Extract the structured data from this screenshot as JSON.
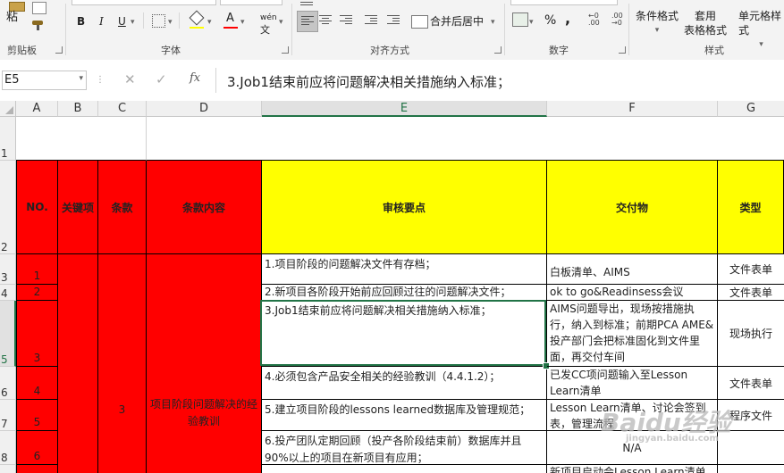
{
  "ribbon": {
    "clipboard": {
      "paste_label": "粘",
      "group_label": "剪贴板"
    },
    "font": {
      "group_label": "字体",
      "bold": "B",
      "italic": "I",
      "underline": "U",
      "font_color_glyph": "A",
      "phonetic": "wén"
    },
    "alignment": {
      "group_label": "对齐方式",
      "merge_label": "合并后居中"
    },
    "number": {
      "group_label": "数字",
      "percent": "%",
      "comma": ","
    },
    "styles": {
      "group_label": "样式",
      "conditional_label": "条件格式",
      "table_label_1": "套用",
      "table_label_2": "表格格式",
      "cell_style_label": "单元格样式"
    }
  },
  "formula_bar": {
    "name_box": "E5",
    "fx": "fx",
    "content": "3.Job1结束前应将问题解决相关措施纳入标准；"
  },
  "columns": [
    "A",
    "B",
    "C",
    "D",
    "E",
    "F",
    "G"
  ],
  "selected_column": "E",
  "rows": [
    "1",
    "2",
    "3",
    "4",
    "5",
    "6",
    "7",
    "8"
  ],
  "selected_row": "5",
  "header_row": {
    "no": "NO.",
    "key": "关键项",
    "clause": "条款",
    "clause_content": "条款内容",
    "audit_points": "审核要点",
    "deliverables": "交付物",
    "type": "类型"
  },
  "merged": {
    "clause": "3",
    "clause_content": "项目阶段问题解决的经验教训"
  },
  "data_rows": [
    {
      "no": "1",
      "audit": "1.项目阶段的问题解决文件有存档；",
      "deliverable": "白板清单、AIMS",
      "type": "文件表单"
    },
    {
      "no": "2",
      "audit": "2.新项目各阶段开始前应回顾过往的问题解决文件；",
      "deliverable": "ok to go&Readinsess会议",
      "type": "文件表单"
    },
    {
      "no": "3",
      "audit": "3.Job1结束前应将问题解决相关措施纳入标准；",
      "deliverable": "AIMS问题导出，现场按措施执行，纳入到标准；前期PCA AME&投产部门会把标准固化到文件里面，再交付车间",
      "type": "现场执行"
    },
    {
      "no": "4",
      "audit": "4.必须包含产品安全相关的经验教训（4.4.1.2）；",
      "deliverable": "已发CC项问题输入至Lesson Learn清单",
      "type": "文件表单"
    },
    {
      "no": "5",
      "audit": "5.建立项目阶段的lessons learned数据库及管理规范；",
      "deliverable": "Lesson Learn清单、讨论会签到表，管理流程",
      "type": "程序文件"
    },
    {
      "no": "6",
      "audit": "6.投产团队定期回顾（投产各阶段结束前）数据库并且90%以上的项目在新项目有应用；",
      "deliverable": "N/A",
      "type": ""
    },
    {
      "no": "",
      "audit": "",
      "deliverable": "新项目启动会Lesson Learn清单回",
      "type": ""
    }
  ],
  "watermark": {
    "text": "Baidu经验",
    "sub": "jingyan.baidu.com"
  },
  "colors": {
    "header_fill": "#ffff00",
    "left_fill": "#ff0000",
    "accent": "#217346"
  }
}
